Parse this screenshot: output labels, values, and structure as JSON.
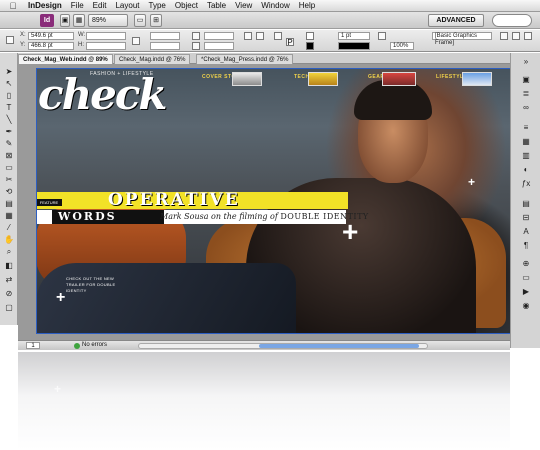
{
  "menu": {
    "app": "InDesign",
    "items": [
      "File",
      "Edit",
      "Layout",
      "Type",
      "Object",
      "Table",
      "View",
      "Window",
      "Help"
    ]
  },
  "appbar": {
    "icon_label": "Id",
    "zoom": "89%",
    "workspace": "ADVANCED"
  },
  "control": {
    "x": "549.6 pt",
    "y": "466.8 pt",
    "stroke_weight": "1 pt",
    "opacity": "100%",
    "object_style": "[Basic Graphics Frame]"
  },
  "tabs": [
    {
      "label": "Check_Mag_Web.indd @ 89%",
      "active": true
    },
    {
      "label": "Check_Mag.indd @ 76%",
      "active": false
    },
    {
      "label": "*Check_Mag_Press.indd @ 76%",
      "active": false
    }
  ],
  "magazine": {
    "logo": "check",
    "fashion": "FASHION + LIFESTYLE",
    "nav": [
      "COVER STORY",
      "TECH",
      "GEAR",
      "LIFESTYLE"
    ],
    "feature_tag": "FEATURE",
    "headline": "OPERATIVE",
    "words": "WORDS",
    "subhead_text": "Mark Sousa on the filming of",
    "subhead_title": "DOUBLE IDENTITY",
    "teaser": "CHECK OUT THE NEW TRAILER FOR DOUBLE IDENTITY"
  },
  "status": {
    "page": "1",
    "preflight": "No errors"
  }
}
